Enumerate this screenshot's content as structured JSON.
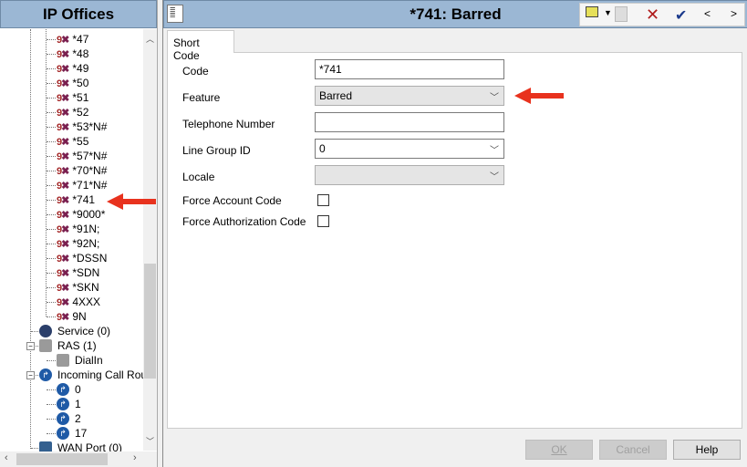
{
  "left_panel": {
    "title": "IP Offices",
    "short_codes": [
      "*47",
      "*48",
      "*49",
      "*50",
      "*51",
      "*52",
      "*53*N#",
      "*55",
      "*57*N#",
      "*70*N#",
      "*71*N#",
      "*741",
      "*9000*",
      "*91N;",
      "*92N;",
      "*DSSN",
      "*SDN",
      "*SKN",
      "4XXX",
      "9N"
    ],
    "nodes": [
      {
        "label": "Service (0)",
        "icon": "globe-icon"
      },
      {
        "label": "RAS (1)",
        "icon": "ras-icon",
        "expander": "−"
      },
      {
        "label": "DialIn",
        "icon": "ras-icon"
      },
      {
        "label": "Incoming Call Route",
        "icon": "route-icon",
        "expander": "−"
      },
      {
        "label": "0",
        "icon": "route-icon"
      },
      {
        "label": "1",
        "icon": "route-icon"
      },
      {
        "label": "2",
        "icon": "route-icon"
      },
      {
        "label": "17",
        "icon": "route-icon"
      },
      {
        "label": "WAN Port (0)",
        "icon": "wan-icon"
      }
    ]
  },
  "right_panel": {
    "title": "*741: Barred",
    "tab": "Short Code",
    "form": {
      "code": {
        "label": "Code",
        "value": "*741"
      },
      "feature": {
        "label": "Feature",
        "value": "Barred"
      },
      "telephone": {
        "label": "Telephone Number",
        "value": ""
      },
      "line_group": {
        "label": "Line Group ID",
        "value": "0"
      },
      "locale": {
        "label": "Locale",
        "value": ""
      },
      "force_account": {
        "label": "Force Account Code",
        "checked": false
      },
      "force_auth": {
        "label": "Force Authorization Code",
        "checked": false
      }
    },
    "buttons": {
      "ok": "OK",
      "cancel": "Cancel",
      "help": "Help"
    },
    "toolbar": {
      "prev": "<",
      "next": ">"
    }
  },
  "colors": {
    "header": "#9bb7d4",
    "arrow": "#e8321e"
  }
}
